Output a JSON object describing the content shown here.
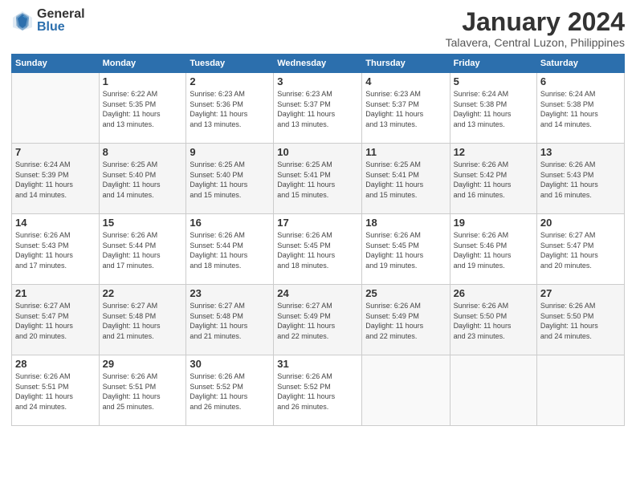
{
  "logo": {
    "general": "General",
    "blue": "Blue"
  },
  "header": {
    "title": "January 2024",
    "subtitle": "Talavera, Central Luzon, Philippines"
  },
  "weekdays": [
    "Sunday",
    "Monday",
    "Tuesday",
    "Wednesday",
    "Thursday",
    "Friday",
    "Saturday"
  ],
  "weeks": [
    [
      {
        "day": "",
        "info": ""
      },
      {
        "day": "1",
        "info": "Sunrise: 6:22 AM\nSunset: 5:35 PM\nDaylight: 11 hours\nand 13 minutes."
      },
      {
        "day": "2",
        "info": "Sunrise: 6:23 AM\nSunset: 5:36 PM\nDaylight: 11 hours\nand 13 minutes."
      },
      {
        "day": "3",
        "info": "Sunrise: 6:23 AM\nSunset: 5:37 PM\nDaylight: 11 hours\nand 13 minutes."
      },
      {
        "day": "4",
        "info": "Sunrise: 6:23 AM\nSunset: 5:37 PM\nDaylight: 11 hours\nand 13 minutes."
      },
      {
        "day": "5",
        "info": "Sunrise: 6:24 AM\nSunset: 5:38 PM\nDaylight: 11 hours\nand 13 minutes."
      },
      {
        "day": "6",
        "info": "Sunrise: 6:24 AM\nSunset: 5:38 PM\nDaylight: 11 hours\nand 14 minutes."
      }
    ],
    [
      {
        "day": "7",
        "info": "Sunrise: 6:24 AM\nSunset: 5:39 PM\nDaylight: 11 hours\nand 14 minutes."
      },
      {
        "day": "8",
        "info": "Sunrise: 6:25 AM\nSunset: 5:40 PM\nDaylight: 11 hours\nand 14 minutes."
      },
      {
        "day": "9",
        "info": "Sunrise: 6:25 AM\nSunset: 5:40 PM\nDaylight: 11 hours\nand 15 minutes."
      },
      {
        "day": "10",
        "info": "Sunrise: 6:25 AM\nSunset: 5:41 PM\nDaylight: 11 hours\nand 15 minutes."
      },
      {
        "day": "11",
        "info": "Sunrise: 6:25 AM\nSunset: 5:41 PM\nDaylight: 11 hours\nand 15 minutes."
      },
      {
        "day": "12",
        "info": "Sunrise: 6:26 AM\nSunset: 5:42 PM\nDaylight: 11 hours\nand 16 minutes."
      },
      {
        "day": "13",
        "info": "Sunrise: 6:26 AM\nSunset: 5:43 PM\nDaylight: 11 hours\nand 16 minutes."
      }
    ],
    [
      {
        "day": "14",
        "info": "Sunrise: 6:26 AM\nSunset: 5:43 PM\nDaylight: 11 hours\nand 17 minutes."
      },
      {
        "day": "15",
        "info": "Sunrise: 6:26 AM\nSunset: 5:44 PM\nDaylight: 11 hours\nand 17 minutes."
      },
      {
        "day": "16",
        "info": "Sunrise: 6:26 AM\nSunset: 5:44 PM\nDaylight: 11 hours\nand 18 minutes."
      },
      {
        "day": "17",
        "info": "Sunrise: 6:26 AM\nSunset: 5:45 PM\nDaylight: 11 hours\nand 18 minutes."
      },
      {
        "day": "18",
        "info": "Sunrise: 6:26 AM\nSunset: 5:45 PM\nDaylight: 11 hours\nand 19 minutes."
      },
      {
        "day": "19",
        "info": "Sunrise: 6:26 AM\nSunset: 5:46 PM\nDaylight: 11 hours\nand 19 minutes."
      },
      {
        "day": "20",
        "info": "Sunrise: 6:27 AM\nSunset: 5:47 PM\nDaylight: 11 hours\nand 20 minutes."
      }
    ],
    [
      {
        "day": "21",
        "info": "Sunrise: 6:27 AM\nSunset: 5:47 PM\nDaylight: 11 hours\nand 20 minutes."
      },
      {
        "day": "22",
        "info": "Sunrise: 6:27 AM\nSunset: 5:48 PM\nDaylight: 11 hours\nand 21 minutes."
      },
      {
        "day": "23",
        "info": "Sunrise: 6:27 AM\nSunset: 5:48 PM\nDaylight: 11 hours\nand 21 minutes."
      },
      {
        "day": "24",
        "info": "Sunrise: 6:27 AM\nSunset: 5:49 PM\nDaylight: 11 hours\nand 22 minutes."
      },
      {
        "day": "25",
        "info": "Sunrise: 6:26 AM\nSunset: 5:49 PM\nDaylight: 11 hours\nand 22 minutes."
      },
      {
        "day": "26",
        "info": "Sunrise: 6:26 AM\nSunset: 5:50 PM\nDaylight: 11 hours\nand 23 minutes."
      },
      {
        "day": "27",
        "info": "Sunrise: 6:26 AM\nSunset: 5:50 PM\nDaylight: 11 hours\nand 24 minutes."
      }
    ],
    [
      {
        "day": "28",
        "info": "Sunrise: 6:26 AM\nSunset: 5:51 PM\nDaylight: 11 hours\nand 24 minutes."
      },
      {
        "day": "29",
        "info": "Sunrise: 6:26 AM\nSunset: 5:51 PM\nDaylight: 11 hours\nand 25 minutes."
      },
      {
        "day": "30",
        "info": "Sunrise: 6:26 AM\nSunset: 5:52 PM\nDaylight: 11 hours\nand 26 minutes."
      },
      {
        "day": "31",
        "info": "Sunrise: 6:26 AM\nSunset: 5:52 PM\nDaylight: 11 hours\nand 26 minutes."
      },
      {
        "day": "",
        "info": ""
      },
      {
        "day": "",
        "info": ""
      },
      {
        "day": "",
        "info": ""
      }
    ]
  ]
}
